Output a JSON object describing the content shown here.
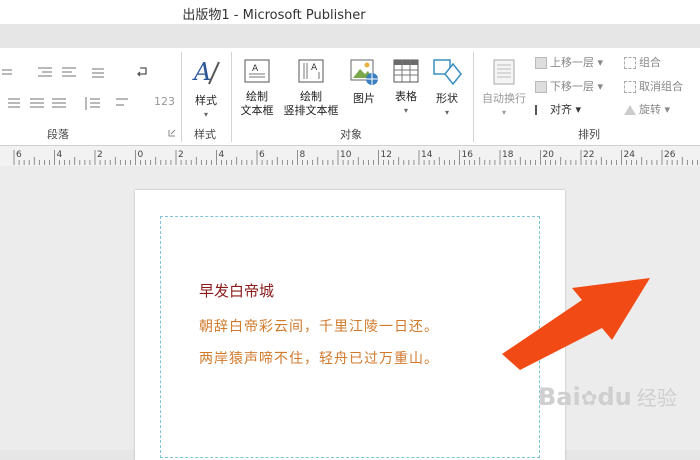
{
  "window": {
    "title": "出版物1 - Microsoft Publisher"
  },
  "ribbon": {
    "groups": {
      "paragraph": "段落",
      "styles": "样式",
      "objects": "对象",
      "arrange": "排列"
    },
    "buttons": {
      "styles": "样式",
      "draw_textbox_l1": "绘制",
      "draw_textbox_l2": "文本框",
      "draw_vertical_l1": "绘制",
      "draw_vertical_l2": "竖排文本框",
      "picture": "图片",
      "table": "表格",
      "shapes": "形状",
      "auto_wrap": "自动换行",
      "bring_forward": "上移一层",
      "send_backward": "下移一层",
      "align": "对齐",
      "group": "组合",
      "ungroup": "取消组合",
      "rotate": "旋转"
    },
    "paragraph_misc": {
      "num": "123"
    }
  },
  "ruler": {
    "labels": [
      "6",
      "4",
      "2",
      "0",
      "2",
      "4",
      "6",
      "8",
      "10",
      "12",
      "14",
      "16",
      "18",
      "20",
      "22",
      "24",
      "26"
    ]
  },
  "document": {
    "title": "早发白帝城",
    "lines": [
      "朝辞白帝彩云间，千里江陵一日还。",
      "两岸猿声啼不住，轻舟已过万重山。"
    ]
  },
  "watermark": {
    "brand": "Bai",
    "brand2": "du",
    "suffix": "经验"
  },
  "colors": {
    "arrow": "#f24a14",
    "title": "#8b1a1a",
    "poem": "#d17a2c",
    "textbox_border": "#7ec3d6"
  }
}
